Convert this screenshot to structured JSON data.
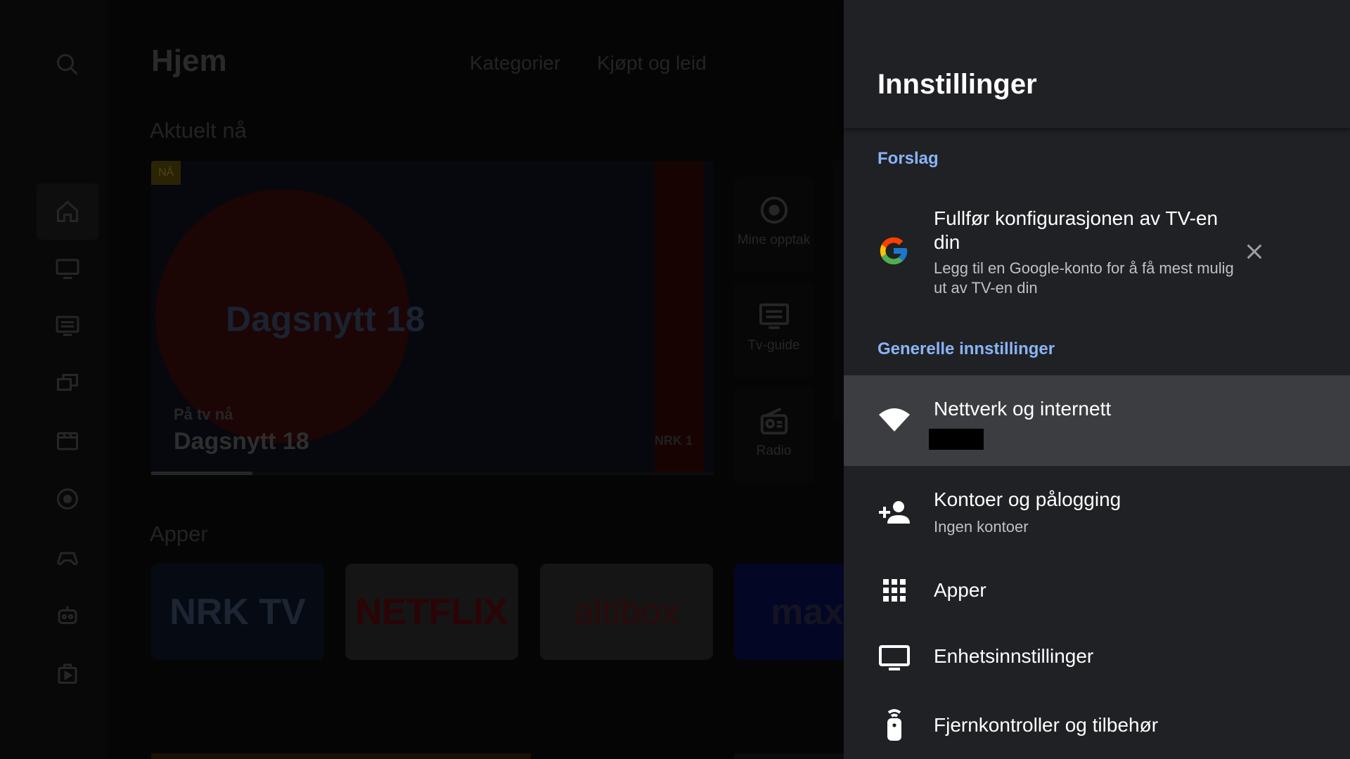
{
  "home": {
    "title": "Hjem",
    "tabs": [
      "Kategorier",
      "Kjøpt og leid"
    ],
    "section_now": "Aktuelt nå",
    "hero": {
      "badge": "NÅ",
      "overlay_title": "Dagsnytt 18",
      "on_tv_label": "På tv nå",
      "program_title": "Dagsnytt 18",
      "channel_logo": "NRK 1",
      "progress": 0.18
    },
    "side_tiles": [
      {
        "label": "Mine opptak",
        "icon": "record-icon"
      },
      {
        "label": "Tv-guide",
        "icon": "tv-guide-icon"
      },
      {
        "label": "Radio",
        "icon": "radio-icon"
      }
    ],
    "section_apps": "Apper",
    "apps": [
      "NRK TV",
      "NETFLIX",
      "altibox",
      "max"
    ],
    "rail_icons": [
      "search-icon",
      "home-icon",
      "tv-icon",
      "guide-icon",
      "multiview-icon",
      "movie-icon",
      "record-icon",
      "gamepad-icon",
      "robot-icon",
      "play-store-icon"
    ]
  },
  "settings": {
    "title": "Innstillinger",
    "suggestions_label": "Forslag",
    "suggestion": {
      "title": "Fullfør konfigurasjonen av TV-en din",
      "subtitle": "Legg til en Google-konto for å få mest mulig ut av TV-en din",
      "icon": "google-icon"
    },
    "general_label": "Generelle innstillinger",
    "items": [
      {
        "title": "Nettverk og internett",
        "subtitle": "",
        "icon": "wifi-icon",
        "focused": true
      },
      {
        "title": "Kontoer og pålogging",
        "subtitle": "Ingen kontoer",
        "icon": "add-account-icon"
      },
      {
        "title": "Apper",
        "subtitle": "",
        "icon": "apps-grid-icon"
      },
      {
        "title": "Enhetsinnstillinger",
        "subtitle": "",
        "icon": "monitor-icon"
      },
      {
        "title": "Fjernkontroller og tilbehør",
        "subtitle": "",
        "icon": "remote-icon"
      }
    ],
    "colors": {
      "panel": "#202124",
      "focus": "#3c3d40",
      "accent": "#8ab4f8"
    }
  }
}
